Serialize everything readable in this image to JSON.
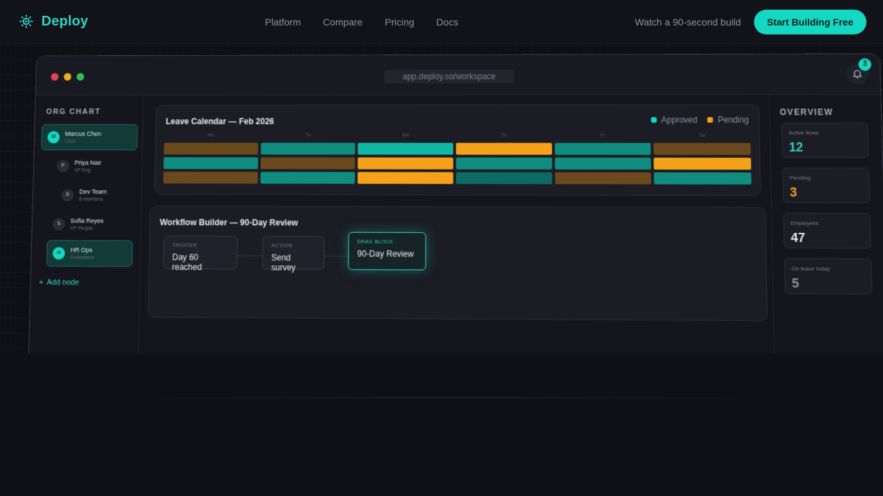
{
  "nav": {
    "brand": "Deploy",
    "links": [
      "Platform",
      "Compare",
      "Pricing",
      "Docs"
    ],
    "watch_label": "Watch a 90-second build",
    "cta_label": "Start Building Free"
  },
  "window": {
    "url": "app.deploy.so/workspace",
    "notification_count": "3"
  },
  "sidebar": {
    "title": "ORG CHART",
    "nodes": [
      {
        "initial": "M",
        "name": "Marcus Chen",
        "role": "CEO"
      },
      {
        "initial": "P",
        "name": "Priya Nair",
        "role": "VP Eng"
      },
      {
        "initial": "D",
        "name": "Dev Team",
        "role": "8 members"
      },
      {
        "initial": "S",
        "name": "Sofia Reyes",
        "role": "VP People"
      },
      {
        "initial": "H",
        "name": "HR Ops",
        "role": "3 members"
      }
    ],
    "add_label": "Add node"
  },
  "calendar": {
    "title": "Leave Calendar — Feb 2026",
    "legend": {
      "approved": "Approved",
      "pending": "Pending"
    },
    "days": [
      "Mo",
      "Tu",
      "We",
      "Th",
      "Fr",
      "Sa"
    ],
    "rows": [
      [
        "pending-dim",
        "approved",
        "approved-bright",
        "pending",
        "approved",
        "pending-dim"
      ],
      [
        "approved",
        "pending-dim",
        "pending",
        "approved",
        "approved",
        "pending"
      ],
      [
        "pending-dim",
        "approved",
        "pending",
        "approved-dim",
        "pending-dim",
        "approved"
      ]
    ]
  },
  "workflow": {
    "title": "Workflow Builder — 90-Day Review",
    "trigger": {
      "type": "TRIGGER",
      "value": "Day 60 reached"
    },
    "action": {
      "type": "ACTION",
      "value": "Send survey"
    },
    "drag": {
      "type": "DRAG BLOCK",
      "value": "90-Day Review"
    }
  },
  "overview": {
    "title": "OVERVIEW",
    "stats": [
      {
        "label": "Active flows",
        "value": "12",
        "color": "#2ed3c4"
      },
      {
        "label": "Pending",
        "value": "3",
        "color": "#f5a21a"
      },
      {
        "label": "Employees",
        "value": "47",
        "color": "#e6e8ee"
      },
      {
        "label": "On leave today",
        "value": "5",
        "color": "#8d92a0"
      }
    ]
  },
  "colors": {
    "accent": "#14d8c2",
    "pending": "#f5a21a",
    "background": "#0f0f16"
  }
}
